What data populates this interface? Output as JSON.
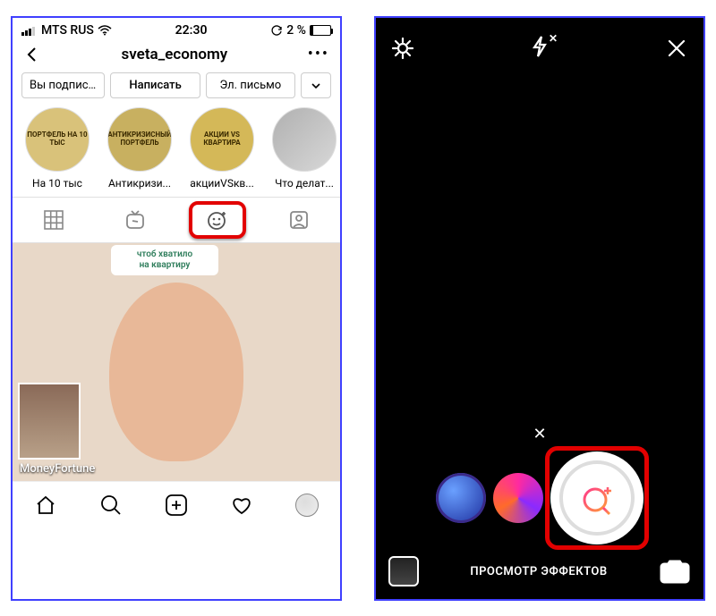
{
  "left": {
    "status": {
      "carrier": "MTS RUS",
      "time": "22:30",
      "battery_text": "2 %"
    },
    "nav": {
      "username": "sveta_economy"
    },
    "actions": {
      "subscribed": "Вы подпис...",
      "message": "Написать",
      "email": "Эл. письмо"
    },
    "highlights": [
      {
        "circle_text": "ПОРТФЕЛЬ\nНА 10 ТЫС",
        "label": "На 10 тыс"
      },
      {
        "circle_text": "АНТИКРИЗИСНЫЙ\nПОРТФЕЛЬ",
        "label": "Антикризи..."
      },
      {
        "circle_text": "АКЦИИ VS\nКВАРТИРА",
        "label": "акцииVSкв..."
      },
      {
        "circle_text": "",
        "label": "Что делат..."
      }
    ],
    "post": {
      "card_line1": "чтоб хватило",
      "card_line2": "на квартиру",
      "thumb_label": "MoneyFortune"
    }
  },
  "right": {
    "close_x": "✕",
    "footer_label": "ПРОСМОТР ЭФФЕКТОВ"
  }
}
